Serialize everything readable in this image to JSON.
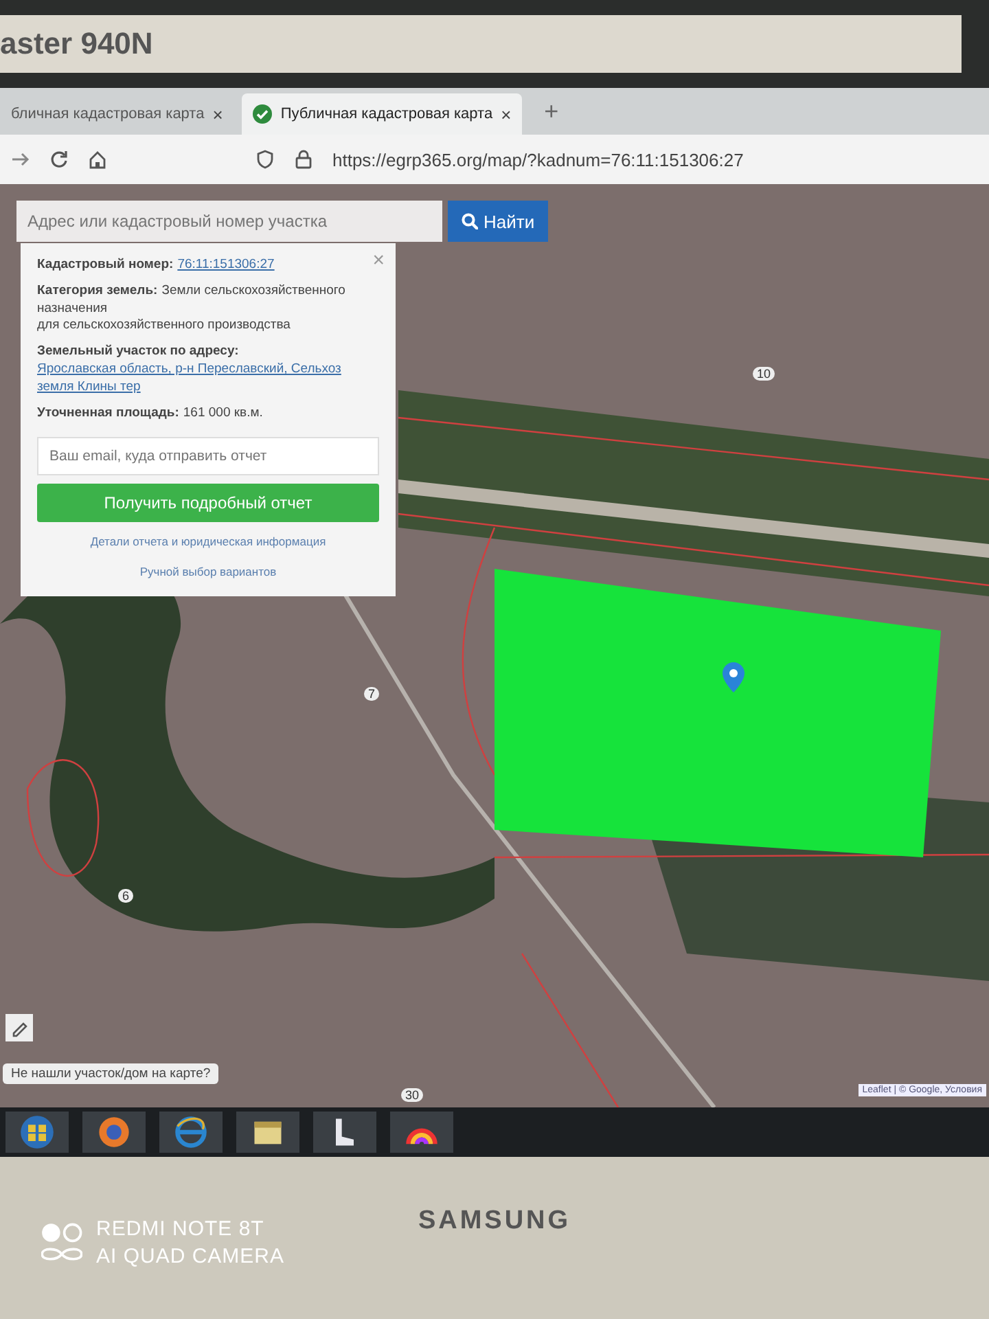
{
  "monitor": {
    "model": "aster 940N",
    "brand": "SAMSUNG"
  },
  "browser": {
    "tabs": [
      {
        "title": "бличная кадастровая карта",
        "close": "×",
        "selected": false
      },
      {
        "title": "Публичная кадастровая карта",
        "close": "×",
        "selected": true
      }
    ],
    "new_tab": "+",
    "url": "https://egrp365.org/map/?kadnum=76:11:151306:27"
  },
  "map": {
    "search": {
      "placeholder": "Адрес или кадастровый номер участка",
      "button": "Найти"
    },
    "popup": {
      "close": "×",
      "fields": [
        {
          "label": "Кадастровый номер:",
          "value": "76:11:151306:27",
          "kind": "link"
        },
        {
          "label": "Категория земель:",
          "value": "Земли сельскохозяйственного назначения\nдля сельскохозяйственного производства",
          "kind": "text"
        },
        {
          "label": "Земельный участок по адресу:",
          "value": "Ярославская область, р-н Переславский, Сельхоз земля Клины тер",
          "kind": "link"
        },
        {
          "label": "Уточненная площадь:",
          "value": "161 000 кв.м.",
          "kind": "text"
        }
      ],
      "email_placeholder": "Ваш email, куда отправить отчет",
      "button": "Получить подробный отчет",
      "links": [
        "Детали отчета и юридическая информация",
        "Ручной выбор вариантов"
      ]
    },
    "parcel_labels": [
      "10",
      "7",
      "6",
      "30"
    ],
    "hint": "Не нашли участок/дом на карте?",
    "attribution": "Leaflet | © Google, Условия"
  },
  "camera_stamp": [
    "REDMI NOTE 8T",
    "AI QUAD CAMERA"
  ]
}
